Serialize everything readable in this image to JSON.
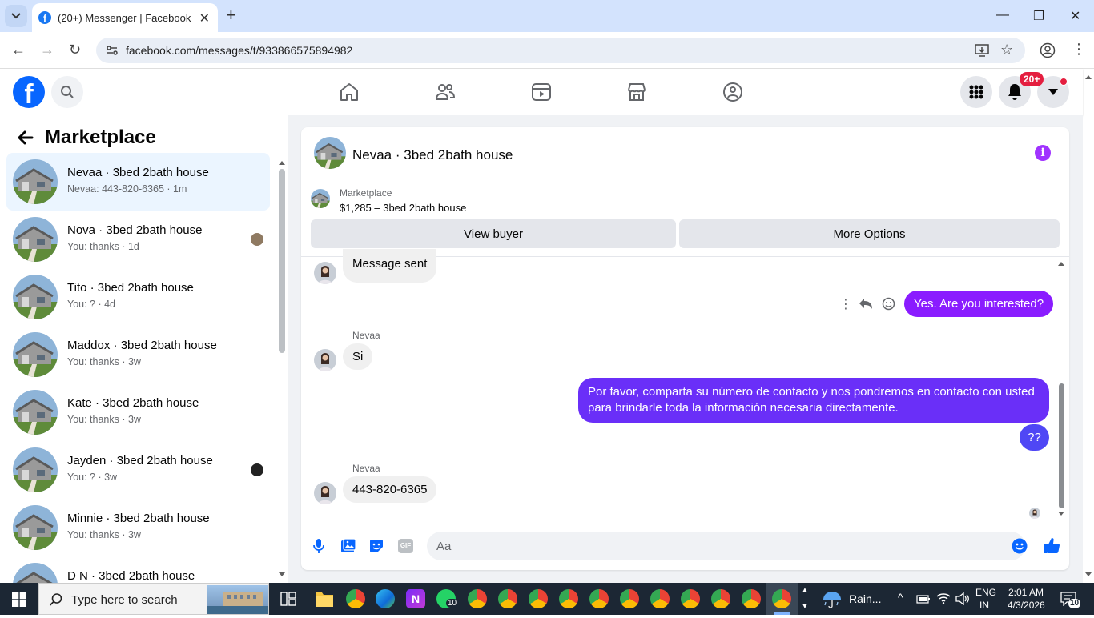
{
  "browser": {
    "tab_title": "(20+) Messenger | Facebook",
    "url": "facebook.com/messages/t/933866575894982"
  },
  "header": {
    "logo": "f",
    "notification_count": "20+"
  },
  "sidebar": {
    "title": "Marketplace",
    "conversations": [
      {
        "name": "Nevaa · 3bed 2bath house",
        "snippet": "Nevaa: 443-820-6365 · 1m"
      },
      {
        "name": "Nova · 3bed 2bath house",
        "snippet": "You: thanks · 1d"
      },
      {
        "name": "Tito · 3bed 2bath house",
        "snippet": "You: ? · 4d"
      },
      {
        "name": "Maddox · 3bed 2bath house",
        "snippet": "You: thanks · 3w"
      },
      {
        "name": "Kate · 3bed 2bath house",
        "snippet": "You: thanks · 3w"
      },
      {
        "name": "Jayden · 3bed 2bath house",
        "snippet": "You: ? · 3w"
      },
      {
        "name": "Minnie · 3bed 2bath house",
        "snippet": "You: thanks · 3w"
      },
      {
        "name": "D N · 3bed 2bath house",
        "snippet": ""
      }
    ]
  },
  "chat": {
    "title": "Nevaa · 3bed 2bath house",
    "marketplace_label": "Marketplace",
    "listing": "$1,285 – 3bed 2bath house",
    "view_buyer": "View buyer",
    "more_options": "More Options",
    "messages": {
      "m1": "Message sent",
      "m2": "Yes. Are you interested?",
      "sender1": "Nevaa",
      "m3": "Si",
      "m4": "Por favor, comparta su número de contacto y nos pondremos en contacto con usted para brindarle toda la información necesaria directamente.",
      "m5": "??",
      "sender2": "Nevaa",
      "m6": "443-820-6365"
    },
    "composer_placeholder": "Aa",
    "gif_label": "GIF"
  },
  "taskbar": {
    "search_placeholder": "Type here to search",
    "weather": "Rain...",
    "lang1": "ENG",
    "lang2": "IN",
    "time": "2:01 AM",
    "date": "4/3/2026",
    "notif_count": "10",
    "whatsapp_count": "10"
  },
  "colors": {
    "fb_blue": "#0866ff",
    "messenger_purple": "#7a1eff",
    "badge_red": "#e41e3f"
  }
}
